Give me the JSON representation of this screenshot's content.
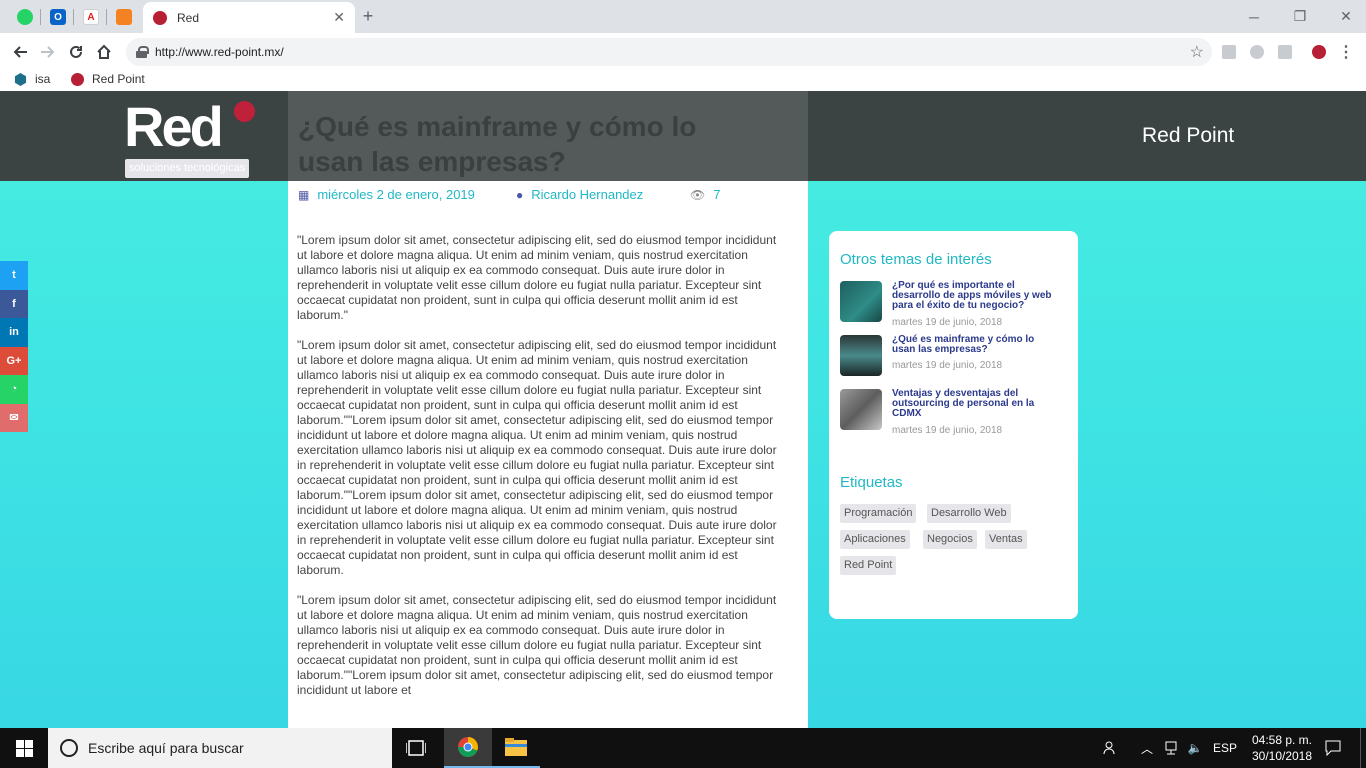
{
  "browser": {
    "tab_title": "Red",
    "url": "http://www.red-point.mx/",
    "bookmarks": [
      "isa",
      "Red Point"
    ]
  },
  "site": {
    "logo_word": "Red",
    "logo_tagline": "soluciones tecnológicas",
    "brand": "Red Point"
  },
  "article": {
    "title": "¿Qué es mainframe y cómo lo usan las empresas?",
    "date": "miércoles 2 de enero, 2019",
    "author": "Ricardo Hernandez",
    "views": "7",
    "paragraphs": [
      "\"Lorem ipsum dolor sit amet, consectetur adipiscing elit, sed do eiusmod tempor incididunt ut labore et dolore magna aliqua. Ut enim ad minim veniam, quis nostrud exercitation ullamco laboris nisi ut aliquip ex ea commodo consequat. Duis aute irure dolor in reprehenderit in voluptate velit esse cillum dolore eu fugiat nulla pariatur. Excepteur sint occaecat cupidatat non proident, sunt in culpa qui officia deserunt mollit anim id est laborum.\"",
      "\"Lorem ipsum dolor sit amet, consectetur adipiscing elit, sed do eiusmod tempor incididunt ut labore et dolore magna aliqua. Ut enim ad minim veniam, quis nostrud exercitation ullamco laboris nisi ut aliquip ex ea commodo consequat. Duis aute irure dolor in reprehenderit in voluptate velit esse cillum dolore eu fugiat nulla pariatur. Excepteur sint occaecat cupidatat non proident, sunt in culpa qui officia deserunt mollit anim id est laborum.\"\"Lorem ipsum dolor sit amet, consectetur adipiscing elit, sed do eiusmod tempor incididunt ut labore et dolore magna aliqua. Ut enim ad minim veniam, quis nostrud exercitation ullamco laboris nisi ut aliquip ex ea commodo consequat. Duis aute irure dolor in reprehenderit in voluptate velit esse cillum dolore eu fugiat nulla pariatur. Excepteur sint occaecat cupidatat non proident, sunt in culpa qui officia deserunt mollit anim id est laborum.\"\"Lorem ipsum dolor sit amet, consectetur adipiscing elit, sed do eiusmod tempor incididunt ut labore et dolore magna aliqua. Ut enim ad minim veniam, quis nostrud exercitation ullamco laboris nisi ut aliquip ex ea commodo consequat. Duis aute irure dolor in reprehenderit in voluptate velit esse cillum dolore eu fugiat nulla pariatur. Excepteur sint occaecat cupidatat non proident, sunt in culpa qui officia deserunt mollit anim id est laborum.",
      "\"Lorem ipsum dolor sit amet, consectetur adipiscing elit, sed do eiusmod tempor incididunt ut labore et dolore magna aliqua. Ut enim ad minim veniam, quis nostrud exercitation ullamco laboris nisi ut aliquip ex ea commodo consequat. Duis aute irure dolor in reprehenderit in voluptate velit esse cillum dolore eu fugiat nulla pariatur. Excepteur sint occaecat cupidatat non proident, sunt in culpa qui officia deserunt mollit anim id est laborum.\"\"Lorem ipsum dolor sit amet, consectetur adipiscing elit, sed do eiusmod tempor incididunt ut labore et"
    ]
  },
  "sidebar": {
    "related_heading": "Otros temas de interés",
    "posts": [
      {
        "title": "¿Por qué es importante el desarrollo de apps móviles y web para el éxito de tu negocio?",
        "date": "martes 19 de junio, 2018"
      },
      {
        "title": "¿Qué es mainframe y cómo lo usan las empresas?",
        "date": "martes 19 de junio, 2018"
      },
      {
        "title": "Ventajas y desventajas del outsourcing de personal en la CDMX",
        "date": "martes 19 de junio, 2018"
      }
    ],
    "tags_heading": "Etiquetas",
    "tags": [
      "Programación",
      "Desarrollo Web",
      "Aplicaciones",
      "Negocios",
      "Ventas",
      "Red Point"
    ]
  },
  "social": [
    {
      "icon": "twitter-icon",
      "glyph": "t",
      "color": "#1da1f2"
    },
    {
      "icon": "facebook-icon",
      "glyph": "f",
      "color": "#3b5998"
    },
    {
      "icon": "linkedin-icon",
      "glyph": "in",
      "color": "#0077b5"
    },
    {
      "icon": "google-plus-icon",
      "glyph": "G+",
      "color": "#dd4b39"
    },
    {
      "icon": "whatsapp-icon",
      "glyph": "◔",
      "color": "#25d366"
    },
    {
      "icon": "email-icon",
      "glyph": "✉",
      "color": "#e06c6c"
    }
  ],
  "taskbar": {
    "search_placeholder": "Escribe aquí para buscar",
    "language": "ESP",
    "time": "04:58 p. m.",
    "date": "30/10/2018"
  },
  "colors": {
    "accent": "#21b8c5",
    "link": "#2c3a8c",
    "brand_red": "#c0213a",
    "header_bg": "#3b4343"
  }
}
